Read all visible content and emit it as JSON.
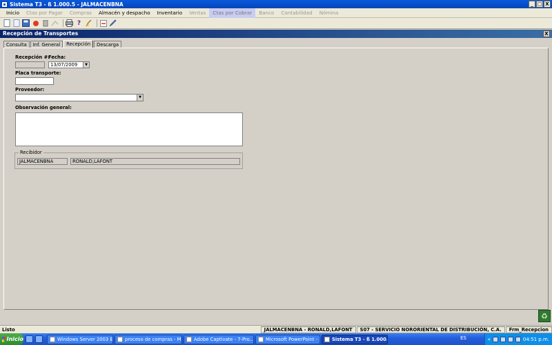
{
  "window": {
    "title": "Sistema T3 - ß 1.000.5 - JALMACENBNA"
  },
  "window_buttons": {
    "minimize": "_",
    "maximize": "□",
    "close": "X"
  },
  "menu": [
    {
      "label": "Inicio",
      "state": "normal"
    },
    {
      "label": "Ctas por Pagar",
      "state": "dim"
    },
    {
      "label": "Compras",
      "state": "dim"
    },
    {
      "label": "Almacén y despacho",
      "state": "normal"
    },
    {
      "label": "Inventario",
      "state": "normal"
    },
    {
      "label": "Ventas",
      "state": "dim"
    },
    {
      "label": "Ctas por Cobrar",
      "state": "active"
    },
    {
      "label": "Banco",
      "state": "dim"
    },
    {
      "label": "Contabilidad",
      "state": "dim"
    },
    {
      "label": "Nómina",
      "state": "dim"
    }
  ],
  "toolbar": {
    "help_glyph": "?"
  },
  "child": {
    "title": "Recepción de Transportes",
    "close": "X",
    "tabs": [
      "Consulta",
      "Inf. General",
      "Recepción",
      "Descarga"
    ],
    "active_tab": "Recepción"
  },
  "form": {
    "recepcion_label": "Recepción #:",
    "recepcion_value": "",
    "fecha_label": "Fecha:",
    "fecha_value": "13/07/2009",
    "placa_label": "Placa transporte:",
    "placa_value": "",
    "proveedor_label": "Proveedor:",
    "proveedor_value": "",
    "observacion_label": "Observación general:",
    "observacion_value": "",
    "recibidor_title": "Recibidor",
    "recibidor_code": "JALMACENBNA",
    "recibidor_name": "RONALD,LAFONT"
  },
  "statusbar": {
    "left": "Listo",
    "user": "JALMACENBNA - RONALD,LAFONT",
    "company": "S07 - SERVICIO NORORIENTAL DE DISTRIBUCIÓN, C.A.",
    "form": "Frm_Recepcion"
  },
  "taskbar": {
    "start": "Inicio",
    "tasks": [
      {
        "label": "Windows Server 2003 En...",
        "active": false
      },
      {
        "label": "proceso de compras - Mi...",
        "active": false
      },
      {
        "label": "Adobe Captivate - 7-Pro...",
        "active": false
      },
      {
        "label": "Microsoft PowerPoint - [...",
        "active": false
      },
      {
        "label": "Sistema T3 - ß 1.000....",
        "active": true
      }
    ],
    "lang": "ES",
    "chevron": "«",
    "clock": "04:51 p.m."
  },
  "colors": {
    "titlebar": "#0a5adc",
    "child_title": "#0a246a",
    "taskbar": "#245edb",
    "start": "#2f8a2f"
  }
}
